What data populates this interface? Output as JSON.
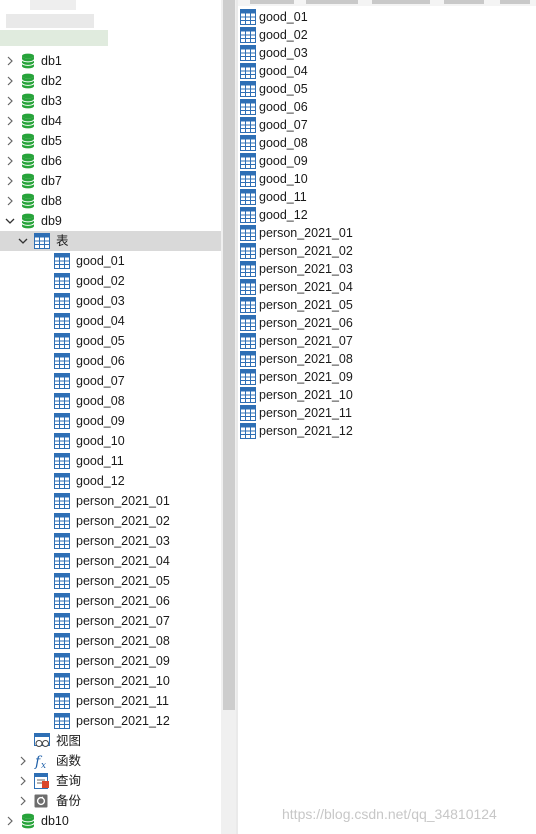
{
  "icons": {
    "database": "database-icon",
    "table": "table-icon",
    "view": "view-icon",
    "function": "function-icon",
    "query": "query-icon",
    "backup": "backup-icon",
    "collapsed": "chevron-right-icon",
    "expanded": "chevron-down-icon"
  },
  "colors": {
    "database_green": "#27a33a",
    "table_blue": "#2e6fb5",
    "selected_row": "#d9d9d9"
  },
  "tree": {
    "databases": [
      "db1",
      "db2",
      "db3",
      "db4",
      "db5",
      "db6",
      "db7",
      "db8"
    ],
    "open_database": {
      "label": "db9",
      "tables_folder": {
        "label": "表",
        "tables": [
          "good_01",
          "good_02",
          "good_03",
          "good_04",
          "good_05",
          "good_06",
          "good_07",
          "good_08",
          "good_09",
          "good_10",
          "good_11",
          "good_12",
          "person_2021_01",
          "person_2021_02",
          "person_2021_03",
          "person_2021_04",
          "person_2021_05",
          "person_2021_06",
          "person_2021_07",
          "person_2021_08",
          "person_2021_09",
          "person_2021_10",
          "person_2021_11",
          "person_2021_12"
        ]
      },
      "views_label": "视图",
      "functions_label": "函数",
      "queries_label": "查询",
      "backups_label": "备份"
    },
    "last_database": "db10"
  },
  "object_list": {
    "tables": [
      "good_01",
      "good_02",
      "good_03",
      "good_04",
      "good_05",
      "good_06",
      "good_07",
      "good_08",
      "good_09",
      "good_10",
      "good_11",
      "good_12",
      "person_2021_01",
      "person_2021_02",
      "person_2021_03",
      "person_2021_04",
      "person_2021_05",
      "person_2021_06",
      "person_2021_07",
      "person_2021_08",
      "person_2021_09",
      "person_2021_10",
      "person_2021_11",
      "person_2021_12"
    ]
  },
  "watermark": "https://blog.csdn.net/qq_34810124"
}
